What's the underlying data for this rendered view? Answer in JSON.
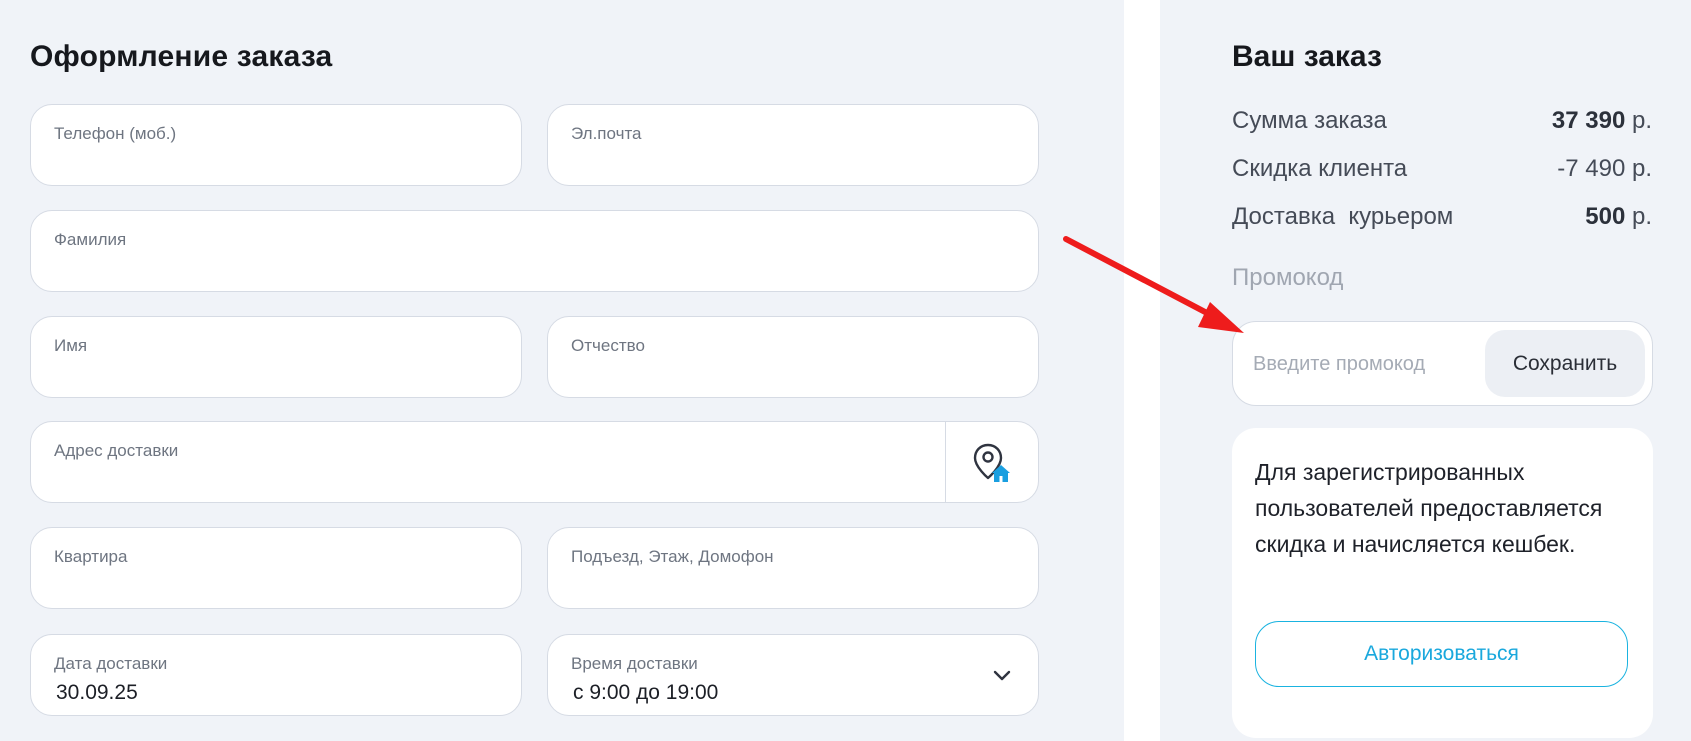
{
  "checkout": {
    "title": "Оформление заказа",
    "fields": {
      "phone": {
        "label": "Телефон (моб.)",
        "value": ""
      },
      "email": {
        "label": "Эл.почта",
        "value": ""
      },
      "last_name": {
        "label": "Фамилия",
        "value": ""
      },
      "first_name": {
        "label": "Имя",
        "value": ""
      },
      "patronymic": {
        "label": "Отчество",
        "value": ""
      },
      "address": {
        "label": "Адрес доставки",
        "value": ""
      },
      "apartment": {
        "label": "Квартира",
        "value": ""
      },
      "entrance": {
        "label": "Подъезд, Этаж, Домофон",
        "value": ""
      },
      "delivery_date": {
        "label": "Дата доставки",
        "value": "30.09.25"
      },
      "delivery_time": {
        "label": "Время доставки",
        "value": "с 9:00 до 19:00"
      }
    },
    "address_icon": "map-pin-home-icon",
    "time_dropdown_icon": "chevron-down-icon"
  },
  "order": {
    "title": "Ваш заказ",
    "rows": [
      {
        "label": "Сумма заказа",
        "value": "37 390",
        "unit": " р."
      },
      {
        "label": "Скидка клиента",
        "value": "-7 490 р.",
        "unit": ""
      },
      {
        "label": "Доставка  курьером",
        "value": "500",
        "unit": " р."
      }
    ],
    "promo": {
      "label": "Промокод",
      "placeholder": "Введите промокод",
      "save_label": "Сохранить"
    },
    "registration": {
      "text": "Для зарегистрированных пользователей предоставляется скидка и начисляется кешбек.",
      "auth_label": "Авторизоваться"
    }
  },
  "colors": {
    "accent": "#1ab3e0",
    "annotation_arrow": "#ee1c1c",
    "icon_home": "#1a9fe0"
  }
}
